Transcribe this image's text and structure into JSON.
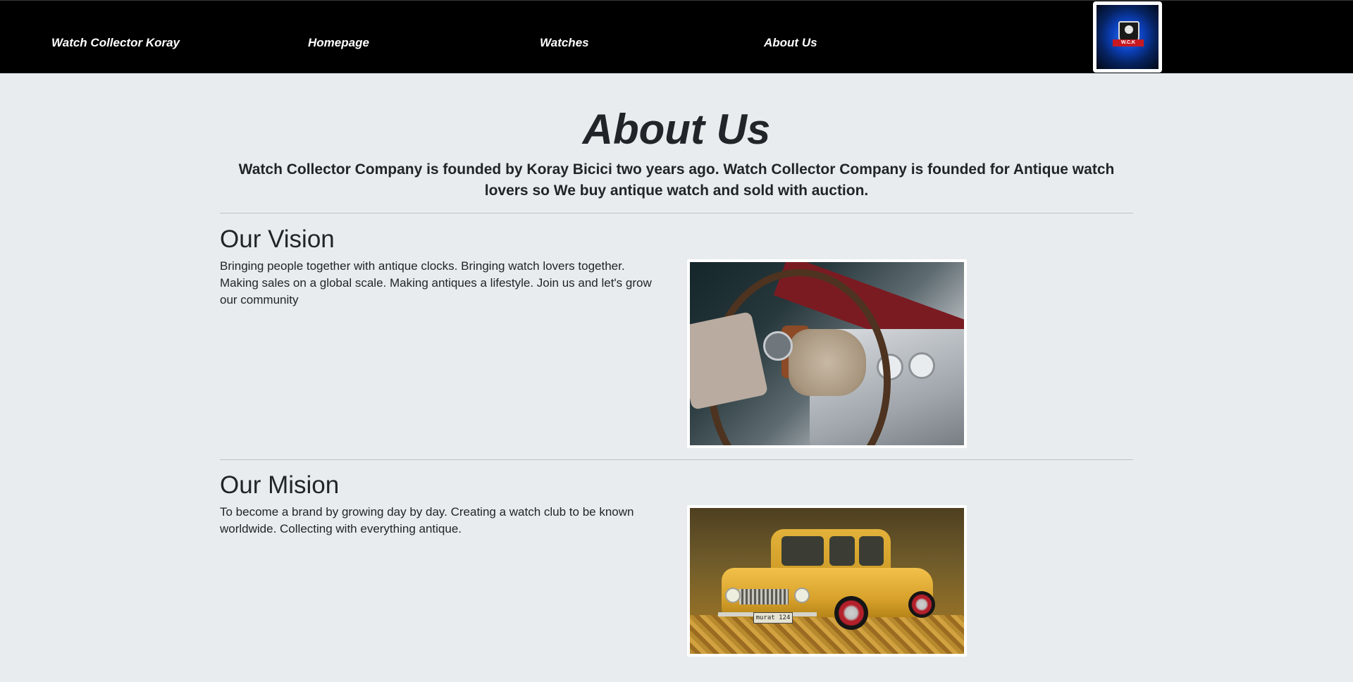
{
  "nav": {
    "brand": "Watch Collector Koray",
    "links": [
      {
        "label": "Homepage"
      },
      {
        "label": "Watches"
      },
      {
        "label": "About Us"
      }
    ],
    "logo_text": "W.C.K"
  },
  "page": {
    "title": "About Us",
    "intro": "Watch Collector Company is founded by Koray Bicici two years ago. Watch Collector Company is founded for Antique watch lovers so We buy antique watch and sold with auction."
  },
  "sections": [
    {
      "title": "Our Vision",
      "text": "Bringing people together with antique clocks. Bringing watch lovers together. Making sales on a global scale. Making antiques a lifestyle. Join us and let's grow our community",
      "image": "vintage-car-dashboard-photo"
    },
    {
      "title": "Our Mision",
      "text": "To become a brand by growing day by day. Creating a watch club to be known worldwide. Collecting with everything antique.",
      "image": "yellow-classic-car-photo",
      "plate_text": "murat 124"
    }
  ],
  "colors": {
    "navbar_bg": "#000000",
    "page_bg": "#e8ecef",
    "text": "#212529"
  }
}
